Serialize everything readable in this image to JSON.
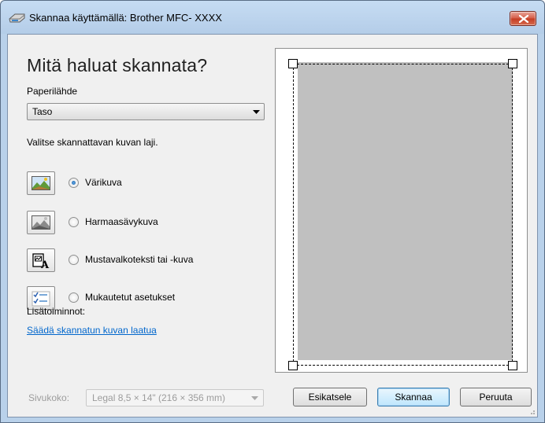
{
  "window": {
    "title": "Skannaa käyttämällä: Brother MFC- XXXX",
    "close_icon": "close-icon"
  },
  "main": {
    "heading": "Mitä haluat skannata?",
    "paper_source_label": "Paperilähde",
    "paper_source_value": "Taso",
    "image_type_label": "Valitse skannattavan kuvan laji.",
    "options": [
      {
        "label": "Värikuva",
        "icon": "color-photo-icon",
        "checked": true
      },
      {
        "label": "Harmaasävykuva",
        "icon": "grayscale-photo-icon",
        "checked": false
      },
      {
        "label": "Mustavalkoteksti tai -kuva",
        "icon": "black-white-text-icon",
        "checked": false
      },
      {
        "label": "Mukautetut asetukset",
        "icon": "custom-settings-icon",
        "checked": false
      }
    ],
    "more_options_label": "Lisätoiminnot:",
    "adjust_quality_link": "Säädä skannatun kuvan laatua"
  },
  "footer": {
    "page_size_label": "Sivukoko:",
    "page_size_value": "Legal 8,5 × 14\" (216 × 356 mm)",
    "preview_button": "Esikatsele",
    "scan_button": "Skannaa",
    "cancel_button": "Peruuta"
  },
  "colors": {
    "titlebar": "#c6dcf3",
    "client_bg": "#f0f0f0",
    "preview_paper": "#c0c0c0",
    "link": "#0066cc"
  }
}
